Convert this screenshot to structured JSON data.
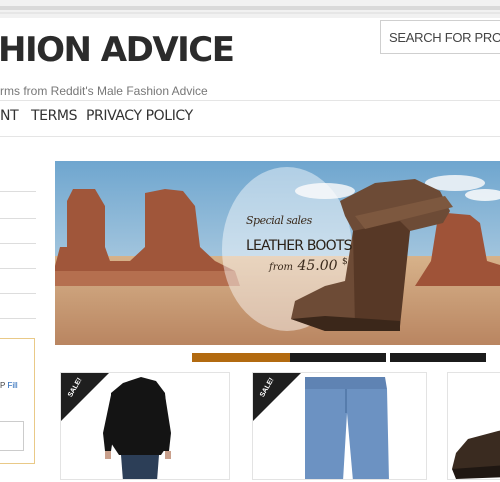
{
  "header": {
    "site_title": "HION ADVICE",
    "tagline": "rms from Reddit's Male Fashion Advice",
    "search_placeholder": "SEARCH FOR PRODUCTS"
  },
  "nav": {
    "items": [
      {
        "label": "NT"
      },
      {
        "label": "TERMS"
      },
      {
        "label": "PRIVACY POLICY"
      }
    ]
  },
  "sidebar": {
    "widget_text": "P Fill",
    "widget_text_prefix": "P",
    "widget_text_link": "Fill"
  },
  "banner": {
    "special": "Special sales",
    "title": "LEATHER BOOTS",
    "price_prefix": "from",
    "price": "45.00",
    "currency": "$"
  },
  "products": [
    {
      "badge": "SALE!",
      "icon": "black-peacoat"
    },
    {
      "badge": "SALE!",
      "icon": "blue-jeans"
    },
    {
      "badge": "",
      "icon": "brown-shoe"
    }
  ],
  "colors": {
    "accent_orange": "#b26a10",
    "slider_dark": "#1b1b1b",
    "widget_border": "#e9c987",
    "link_blue": "#1a5fb4"
  }
}
